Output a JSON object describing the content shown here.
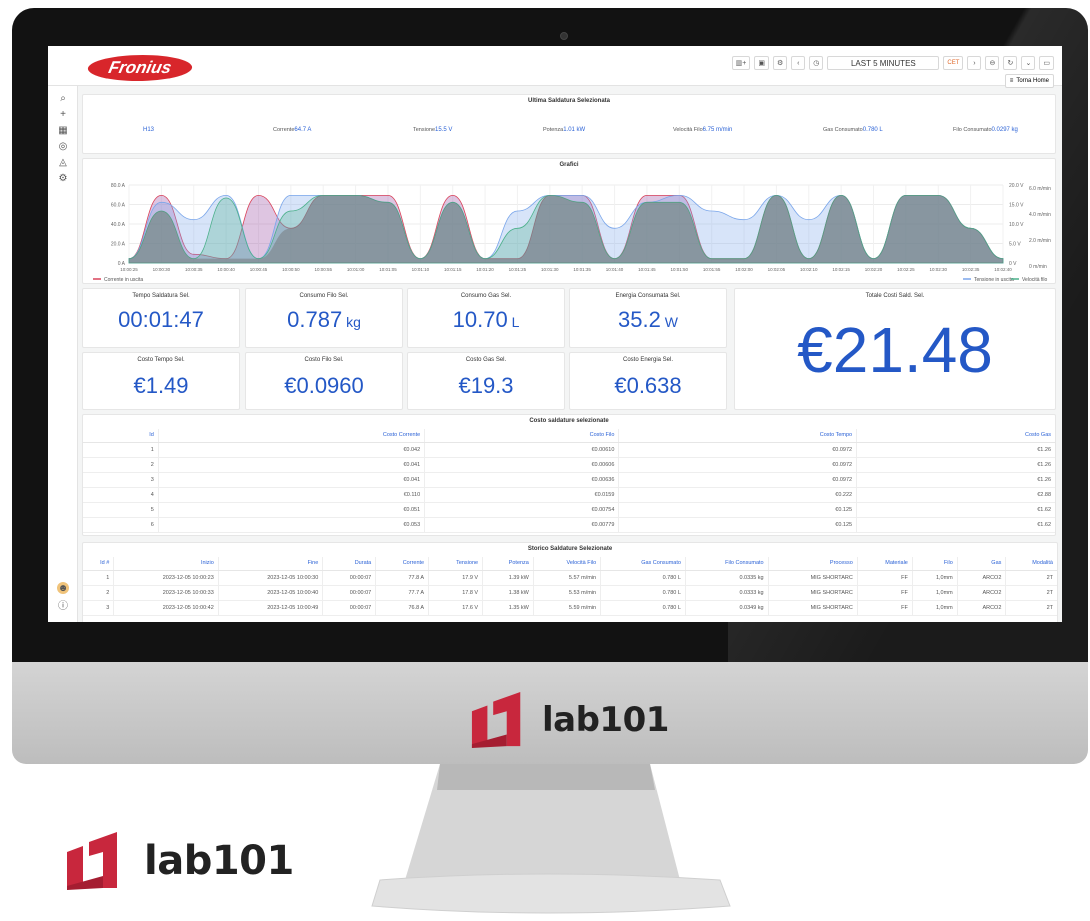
{
  "brand": {
    "fronius": "Fronius",
    "lab101": "lab101"
  },
  "toolbar": {
    "time_range": "LAST 5 MINUTES",
    "timezone": "CET",
    "home": "Torna Home"
  },
  "selected": {
    "title": "Ultima Saldatura Selezionata",
    "items": [
      {
        "label": "",
        "value": "H13"
      },
      {
        "label": "Corrente",
        "value": "64.7 A"
      },
      {
        "label": "Tensione",
        "value": "15.5 V"
      },
      {
        "label": "Potenza",
        "value": "1.01 kW"
      },
      {
        "label": "Velocità Filo",
        "value": "6.75 m/min"
      },
      {
        "label": "Gas Consumato",
        "value": "0.780 L"
      },
      {
        "label": "Filo Consumato",
        "value": "0.0297 kg"
      }
    ]
  },
  "chart_data": {
    "type": "area",
    "title": "Grafici",
    "x": [
      "10:00:25",
      "10:00:30",
      "10:00:35",
      "10:00:40",
      "10:00:45",
      "10:00:50",
      "10:00:55",
      "10:01:00",
      "10:01:05",
      "10:01:10",
      "10:01:15",
      "10:01:20",
      "10:01:25",
      "10:01:30",
      "10:01:35",
      "10:01:40",
      "10:01:45",
      "10:01:50",
      "10:01:55",
      "10:02:00",
      "10:02:05",
      "10:02:10",
      "10:02:15",
      "10:02:20",
      "10:02:25",
      "10:02:30",
      "10:02:35",
      "10:02:40"
    ],
    "y_left_ticks": [
      "0 A",
      "20.0 A",
      "40.0 A",
      "60.0 A",
      "80.0 A"
    ],
    "y_right_volt_ticks": [
      "0 V",
      "5.0 V",
      "10.0 V",
      "15.0 V",
      "20.0 V"
    ],
    "y_right_speed_ticks": [
      "0 m/min",
      "2.0 m/min",
      "4.0 m/min",
      "6.0 m/min"
    ],
    "ylim_left": [
      0,
      90
    ],
    "legend_left": [
      "Corrente in uscita"
    ],
    "legend_right": [
      "Tensione in uscita",
      "Velocità filo"
    ],
    "series": [
      {
        "name": "Corrente in uscita",
        "color": "#d9435a",
        "values": [
          5,
          78,
          10,
          5,
          78,
          40,
          78,
          78,
          78,
          5,
          78,
          5,
          5,
          78,
          78,
          5,
          78,
          78,
          5,
          5,
          78,
          5,
          78,
          5,
          78,
          78,
          40,
          5
        ]
      },
      {
        "name": "Tensione in uscita",
        "color": "#7aa6ea",
        "values": [
          5,
          70,
          50,
          78,
          5,
          78,
          78,
          78,
          70,
          5,
          70,
          5,
          60,
          78,
          78,
          40,
          70,
          78,
          60,
          50,
          78,
          50,
          78,
          5,
          78,
          78,
          40,
          5
        ]
      },
      {
        "name": "Velocità filo",
        "color": "#4bb08a",
        "values": [
          5,
          60,
          5,
          75,
          5,
          60,
          78,
          78,
          70,
          5,
          70,
          5,
          40,
          78,
          70,
          5,
          70,
          70,
          5,
          5,
          78,
          5,
          78,
          5,
          78,
          78,
          40,
          5
        ]
      }
    ]
  },
  "stats": [
    {
      "title": "Tempo Saldatura Sel.",
      "value": "00:01:47",
      "unit": ""
    },
    {
      "title": "Consumo Filo Sel.",
      "value": "0.787",
      "unit": "kg"
    },
    {
      "title": "Consumo Gas Sel.",
      "value": "10.70",
      "unit": "L"
    },
    {
      "title": "Energia Consumata Sel.",
      "value": "35.2",
      "unit": "W"
    },
    {
      "title": "Costo Tempo Sel.",
      "value": "€1.49",
      "unit": ""
    },
    {
      "title": "Costo Filo Sel.",
      "value": "€0.0960",
      "unit": ""
    },
    {
      "title": "Costo Gas Sel.",
      "value": "€19.3",
      "unit": ""
    },
    {
      "title": "Costo Energia Sel.",
      "value": "€0.638",
      "unit": ""
    }
  ],
  "total": {
    "title": "Totale Costi Sald. Sel.",
    "value": "€21.48"
  },
  "costs_table": {
    "title": "Costo saldature selezionate",
    "headers": [
      "Id",
      "Costo Corrente",
      "Costo Filo",
      "Costo Tempo",
      "Costo Gas"
    ],
    "rows": [
      [
        "1",
        "€0.042",
        "€0.00610",
        "€0.0972",
        "€1.26"
      ],
      [
        "2",
        "€0.041",
        "€0.00606",
        "€0.0972",
        "€1.26"
      ],
      [
        "3",
        "€0.041",
        "€0.00636",
        "€0.0972",
        "€1.26"
      ],
      [
        "4",
        "€0.110",
        "€0.0159",
        "€0.222",
        "€2.88"
      ],
      [
        "5",
        "€0.051",
        "€0.00754",
        "€0.125",
        "€1.62"
      ],
      [
        "6",
        "€0.053",
        "€0.00779",
        "€0.125",
        "€1.62"
      ]
    ]
  },
  "history_table": {
    "title": "Storico Saldature Selezionate",
    "headers": [
      "Id #",
      "Inizio",
      "Fine",
      "Durata",
      "Corrente",
      "Tensione",
      "Potenza",
      "Velocità Filo",
      "Gas Consumato",
      "Filo Consumato",
      "Processo",
      "Materiale",
      "Filo",
      "Gas",
      "Modalità"
    ],
    "rows": [
      [
        "1",
        "2023-12-05 10:00:23",
        "2023-12-05 10:00:30",
        "00:00:07",
        "77.8 A",
        "17.9 V",
        "1.39 kW",
        "5.57 m/min",
        "0.780 L",
        "0.0335 kg",
        "MIG SHORTARC",
        "FF",
        "1,0mm",
        "ARCO2",
        "2T"
      ],
      [
        "2",
        "2023-12-05 10:00:33",
        "2023-12-05 10:00:40",
        "00:00:07",
        "77.7 A",
        "17.8 V",
        "1.38 kW",
        "5.53 m/min",
        "0.780 L",
        "0.0333 kg",
        "MIG SHORTARC",
        "FF",
        "1,0mm",
        "ARCO2",
        "2T"
      ],
      [
        "3",
        "2023-12-05 10:00:42",
        "2023-12-05 10:00:49",
        "00:00:07",
        "76.8 A",
        "17.6 V",
        "1.35 kW",
        "5.59 m/min",
        "0.780 L",
        "0.0349 kg",
        "MIG SHORTARC",
        "FF",
        "1,0mm",
        "ARCO2",
        "2T"
      ]
    ]
  }
}
